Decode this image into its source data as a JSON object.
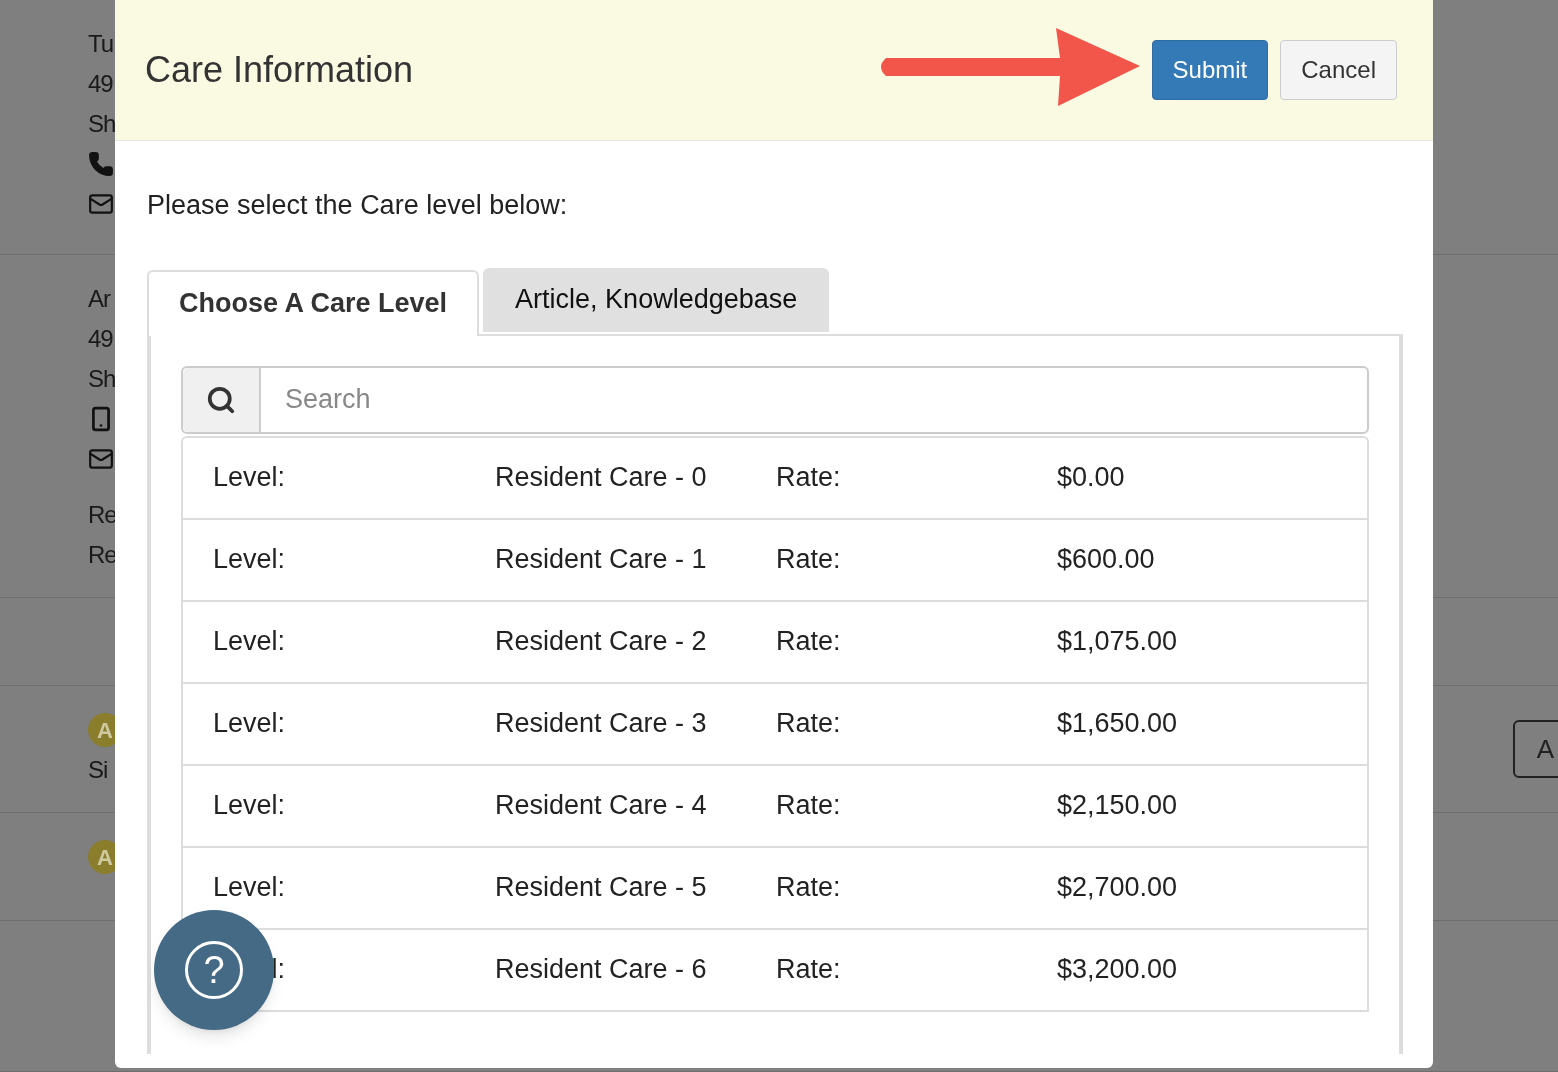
{
  "background": {
    "sections": [
      {
        "lines": [
          {
            "kind": "text",
            "text": "Tu"
          },
          {
            "kind": "text",
            "text": "49"
          },
          {
            "kind": "text",
            "text": "Sh"
          },
          {
            "kind": "phone"
          },
          {
            "kind": "mail"
          }
        ]
      },
      {
        "lines": [
          {
            "kind": "text",
            "text": "Ar"
          },
          {
            "kind": "text",
            "text": "49"
          },
          {
            "kind": "text",
            "text": "Sh"
          },
          {
            "kind": "mobile"
          },
          {
            "kind": "mail"
          },
          {
            "kind": "gap"
          },
          {
            "kind": "text",
            "text": "Re"
          },
          {
            "kind": "text",
            "text": "Re"
          }
        ]
      },
      {
        "lines": [
          {
            "kind": "badge",
            "text": "A"
          },
          {
            "kind": "text",
            "text": "Si"
          }
        ],
        "button": "A"
      },
      {
        "lines": [
          {
            "kind": "badge",
            "text": "A"
          }
        ]
      }
    ]
  },
  "modal": {
    "title": "Care Information",
    "buttons": [
      {
        "label": "Submit",
        "kind": "primary"
      },
      {
        "label": "Cancel",
        "kind": "default"
      }
    ],
    "prompt": "Please select the Care level below:",
    "tabs": [
      {
        "label": "Choose A Care Level",
        "selected": true
      },
      {
        "label": "Article, Knowledgebase",
        "selected": false
      }
    ],
    "search": {
      "placeholder": "Search"
    },
    "rows": [
      {
        "label": "Level:",
        "level": "Resident Care - 0",
        "rate_label": "Rate:",
        "rate": "$0.00"
      },
      {
        "label": "Level:",
        "level": "Resident Care - 1",
        "rate_label": "Rate:",
        "rate": "$600.00"
      },
      {
        "label": "Level:",
        "level": "Resident Care - 2",
        "rate_label": "Rate:",
        "rate": "$1,075.00"
      },
      {
        "label": "Level:",
        "level": "Resident Care - 3",
        "rate_label": "Rate:",
        "rate": "$1,650.00"
      },
      {
        "label": "Level:",
        "level": "Resident Care - 4",
        "rate_label": "Rate:",
        "rate": "$2,150.00"
      },
      {
        "label": "Level:",
        "level": "Resident Care - 5",
        "rate_label": "Rate:",
        "rate": "$2,700.00"
      },
      {
        "label": "l:",
        "level": "Resident Care - 6",
        "rate_label": "Rate:",
        "rate": "$3,200.00"
      }
    ]
  },
  "help": {
    "text": "?"
  }
}
